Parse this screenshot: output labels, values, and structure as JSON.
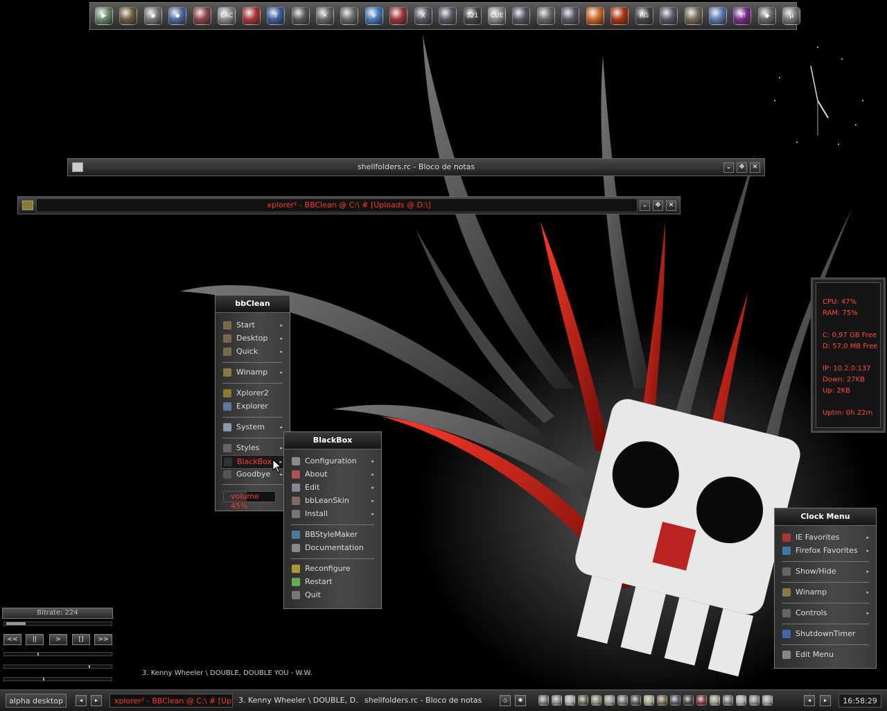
{
  "launcher": {
    "icons": [
      {
        "name": "media-play-icon",
        "color": "#6a8a6a",
        "glyph": "▶"
      },
      {
        "name": "app-tiles-icon",
        "color": "#6b5a3a",
        "glyph": ""
      },
      {
        "name": "disc-burn-icon",
        "color": "#777",
        "glyph": "◉"
      },
      {
        "name": "shield-icon",
        "color": "#4a6a9a",
        "glyph": "◆"
      },
      {
        "name": "image-viewer-icon",
        "color": "#884444",
        "glyph": ""
      },
      {
        "name": "eac-icon",
        "color": "#888",
        "glyph": "EAC"
      },
      {
        "name": "pdf-reader-icon",
        "color": "#aa3333",
        "glyph": ""
      },
      {
        "name": "facebook-icon",
        "color": "#3b5998",
        "glyph": "f"
      },
      {
        "name": "alien-icon",
        "color": "#555",
        "glyph": ""
      },
      {
        "name": "tools-icon",
        "color": "#666",
        "glyph": "✕"
      },
      {
        "name": "server-icon",
        "color": "#666",
        "glyph": ""
      },
      {
        "name": "internet-explorer-icon",
        "color": "#4477bb",
        "glyph": "e"
      },
      {
        "name": "mascot-icon",
        "color": "#993333",
        "glyph": ""
      },
      {
        "name": "xplorer-icon",
        "color": "#556",
        "glyph": "X"
      },
      {
        "name": "window-icon",
        "color": "#556",
        "glyph": ""
      },
      {
        "name": "media-player-classic-icon",
        "color": "#444",
        "glyph": "321"
      },
      {
        "name": "cue-disc-icon",
        "color": "#888",
        "glyph": "CUE"
      },
      {
        "name": "computer-icon",
        "color": "#556",
        "glyph": ""
      },
      {
        "name": "documents-icon",
        "color": "#666",
        "glyph": ""
      },
      {
        "name": "network-icon",
        "color": "#556",
        "glyph": ""
      },
      {
        "name": "firefox-icon",
        "color": "#cc6622",
        "glyph": ""
      },
      {
        "name": "fire-icon",
        "color": "#aa3311",
        "glyph": ""
      },
      {
        "name": "rg-icon",
        "color": "#444",
        "glyph": "RG"
      },
      {
        "name": "task-manager-icon",
        "color": "#556",
        "glyph": ""
      },
      {
        "name": "archive-icon",
        "color": "#776655",
        "glyph": ""
      },
      {
        "name": "messenger-icon",
        "color": "#5577aa",
        "glyph": ""
      },
      {
        "name": "yahoo-messenger-icon",
        "color": "#7a2a8a",
        "glyph": "Y!"
      },
      {
        "name": "diamond-icon",
        "color": "#666",
        "glyph": "◆"
      },
      {
        "name": "utorrent-icon",
        "color": "#777",
        "glyph": "µ"
      }
    ]
  },
  "notepad_window": {
    "title": "shellfolders.rc - Bloco de notas"
  },
  "xplorer_window": {
    "title": "xplorer² - BBClean @ C:\\ # [Uploads @ D:\\]"
  },
  "bbclean_menu": {
    "title": "bbClean",
    "items": [
      {
        "label": "Start",
        "submenu": true
      },
      {
        "label": "Desktop",
        "submenu": true
      },
      {
        "label": "Quick",
        "submenu": true
      },
      {
        "label": "Winamp",
        "submenu": true
      },
      {
        "label": "Xplorer2",
        "submenu": false
      },
      {
        "label": "Explorer",
        "submenu": false
      },
      {
        "label": "System",
        "submenu": true
      },
      {
        "label": "Styles",
        "submenu": true
      },
      {
        "label": "BlackBox",
        "submenu": true
      },
      {
        "label": "Goodbye",
        "submenu": true
      }
    ],
    "volume_label": "volume 45%",
    "volume_level": 0.45
  },
  "blackbox_menu": {
    "title": "BlackBox",
    "items": [
      {
        "label": "Configuration",
        "submenu": true
      },
      {
        "label": "About",
        "submenu": true
      },
      {
        "label": "Edit",
        "submenu": true
      },
      {
        "label": "bbLeanSkin",
        "submenu": true
      },
      {
        "label": "Install",
        "submenu": true
      },
      {
        "label": "BBStyleMaker",
        "submenu": false
      },
      {
        "label": "Documentation",
        "submenu": false
      },
      {
        "label": "Reconfigure",
        "submenu": false
      },
      {
        "label": "Restart",
        "submenu": false
      },
      {
        "label": "Quit",
        "submenu": false
      }
    ]
  },
  "clock_menu": {
    "title": "Clock Menu",
    "items": [
      {
        "label": "IE Favorites",
        "submenu": true
      },
      {
        "label": "Firefox Favorites",
        "submenu": true
      },
      {
        "label": "Show/Hide",
        "submenu": true
      },
      {
        "label": "Winamp",
        "submenu": true
      },
      {
        "label": "Controls",
        "submenu": true
      },
      {
        "label": "ShutdownTimer",
        "submenu": false
      },
      {
        "label": "Edit Menu",
        "submenu": false
      }
    ]
  },
  "system_monitor": {
    "cpu": "CPU: 47%",
    "ram": "RAM: 75%",
    "disk_c": "C: 0,97 GB Free",
    "disk_d": "D: 57,0 MB Free",
    "ip": "IP: 10.2.0.137",
    "down": "Down: 27KB",
    "up": "Up: 2KB",
    "uptime": "Uptm: 0h 22m"
  },
  "player": {
    "bitrate": "Bitrate: 224",
    "buttons": [
      "<<",
      "||",
      ">",
      "[]",
      ">>"
    ],
    "now_playing": "3. Kenny Wheeler \\ DOUBLE, DOUBLE YOU - W.W."
  },
  "taskbar": {
    "workspace": "alpha desktop",
    "tasks": [
      {
        "label": "xplorer² - BBClean @ C:\\ # [Up...",
        "active": true
      },
      {
        "label": "3. Kenny Wheeler \\ DOUBLE, D...",
        "active": false
      },
      {
        "label": "shellfolders.rc - Bloco de notas",
        "active": false
      }
    ],
    "clock": "16:58:29"
  },
  "colors": {
    "accent_red": "#ff3b2f",
    "panel_dark": "#1e1e1e"
  }
}
